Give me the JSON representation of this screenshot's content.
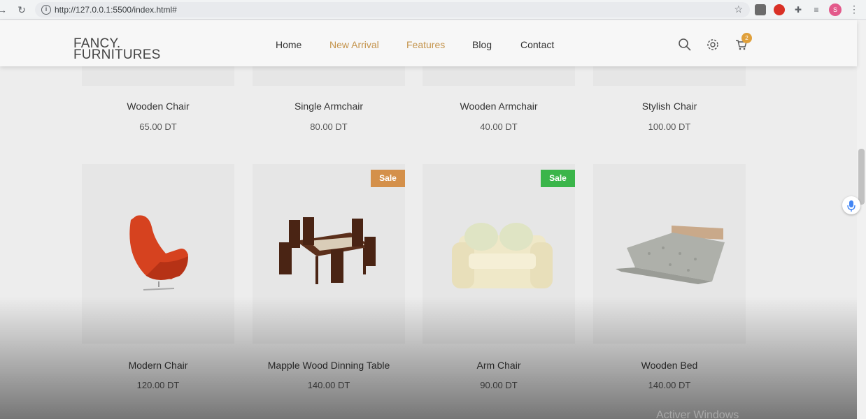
{
  "browser": {
    "url": "http://127.0.0.1:5500/index.html#",
    "profile_initial": "S"
  },
  "site": {
    "logo_line1": "FANCY.",
    "logo_line2": "FURNITURES",
    "nav": [
      {
        "label": "Home"
      },
      {
        "label": "New Arrival"
      },
      {
        "label": "Features"
      },
      {
        "label": "Blog"
      },
      {
        "label": "Contact"
      }
    ],
    "cart_count": "2",
    "accent_color": "#c4944d"
  },
  "products_top": [
    {
      "name": "Wooden Chair",
      "price": "65.00 DT"
    },
    {
      "name": "Single Armchair",
      "price": "80.00 DT"
    },
    {
      "name": "Wooden Armchair",
      "price": "40.00 DT"
    },
    {
      "name": "Stylish Chair",
      "price": "100.00 DT"
    }
  ],
  "products_bottom": [
    {
      "name": "Modern Chair",
      "price": "120.00 DT",
      "badge": "",
      "image": "egg-chair-icon"
    },
    {
      "name": "Mapple Wood Dinning Table",
      "price": "140.00 DT",
      "badge": "Sale",
      "badge_color": "#d4904a",
      "image": "dining-set-icon"
    },
    {
      "name": "Arm Chair",
      "price": "90.00 DT",
      "badge": "Sale",
      "badge_color": "#3bb54a",
      "image": "armchair-icon"
    },
    {
      "name": "Wooden Bed",
      "price": "140.00 DT",
      "badge": "",
      "image": "bed-icon"
    }
  ],
  "watermark": "Activer Windows"
}
